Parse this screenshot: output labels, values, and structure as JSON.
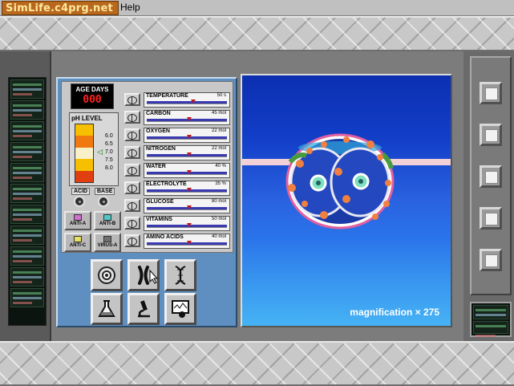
{
  "menubar": {
    "logo_text": "SimLife.c4prg.net",
    "help": "Help"
  },
  "age_days": {
    "label": "AGE DAYS",
    "value": "000"
  },
  "ph": {
    "label": "pH LEVEL",
    "ticks": [
      "6.0",
      "6.5",
      "7.0",
      "7.5",
      "8.0"
    ],
    "acid_label": "ACID",
    "base_label": "BASE",
    "colors": [
      "#f6c000",
      "#f07a10",
      "#f8f0c8",
      "#f6c000",
      "#e04010"
    ]
  },
  "antidotes": [
    {
      "label": "ANTI-A",
      "color": "#d070d0"
    },
    {
      "label": "ANTI-B",
      "color": "#50c8c8"
    },
    {
      "label": "ANTI-C",
      "color": "#e8e060"
    },
    {
      "label": "VIRUS-A",
      "color": "#707070"
    }
  ],
  "nutrients": [
    {
      "name": "TEMPERATURE",
      "value": "50 s",
      "level": 0.55
    },
    {
      "name": "CARBON",
      "value": "45 mol",
      "level": 0.5
    },
    {
      "name": "OXYGEN",
      "value": "22 mol",
      "level": 0.5
    },
    {
      "name": "NITROGEN",
      "value": "22 mol",
      "level": 0.5
    },
    {
      "name": "WATER",
      "value": "40 %",
      "level": 0.5
    },
    {
      "name": "ELECTROLYTE",
      "value": "35 %",
      "level": 0.5
    },
    {
      "name": "GLUCOSE",
      "value": "80 mol",
      "level": 0.5
    },
    {
      "name": "VITAMINS",
      "value": "50 mol",
      "level": 0.5
    },
    {
      "name": "AMINO ACIDS",
      "value": "40 mol",
      "level": 0.5
    }
  ],
  "tools": [
    "cell-view-icon",
    "chromosome-icon",
    "dna-icon",
    "flask-icon",
    "microscope-icon",
    "monitor-icon"
  ],
  "viewport": {
    "magnification": "magnification × 275"
  }
}
